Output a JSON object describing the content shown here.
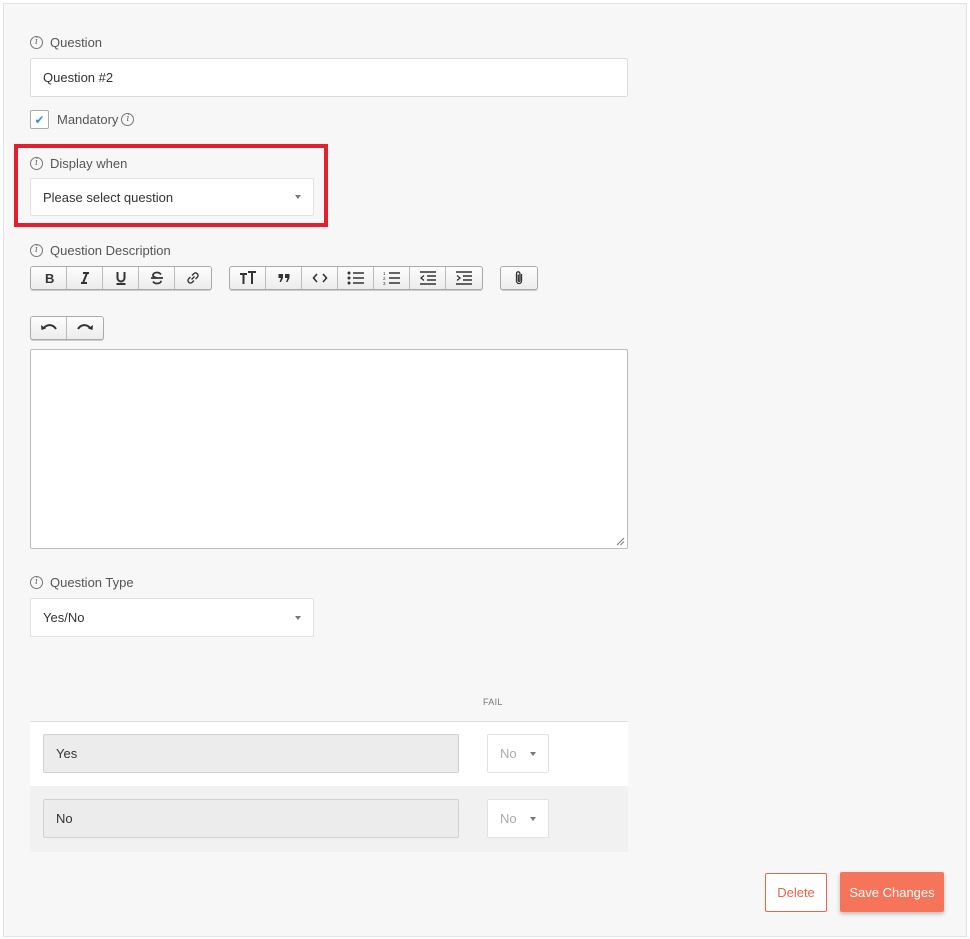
{
  "question": {
    "label": "Question",
    "value": "Question #2"
  },
  "mandatory": {
    "label": "Mandatory",
    "checked": true
  },
  "display_when": {
    "label": "Display when",
    "selected": "Please select question"
  },
  "description": {
    "label": "Question Description",
    "value": ""
  },
  "toolbar": {
    "format_group": [
      "bold-icon",
      "italic-icon",
      "underline-icon",
      "strikethrough-icon",
      "link-icon"
    ],
    "block_group": [
      "heading-icon",
      "quote-icon",
      "code-icon",
      "bullet-list-icon",
      "numbered-list-icon",
      "outdent-icon",
      "indent-icon"
    ],
    "attach_group": [
      "attachment-icon"
    ],
    "history_group": [
      "undo-icon",
      "redo-icon"
    ]
  },
  "question_type": {
    "label": "Question Type",
    "selected": "Yes/No"
  },
  "answers": {
    "fail_header": "FAIL",
    "rows": [
      {
        "answer": "Yes",
        "fail": "No"
      },
      {
        "answer": "No",
        "fail": "No"
      }
    ]
  },
  "actions": {
    "delete_label": "Delete",
    "save_label": "Save Changes"
  },
  "colors": {
    "accent": "#f5745a",
    "highlight": "#e3202d",
    "check": "#3a93d6"
  }
}
